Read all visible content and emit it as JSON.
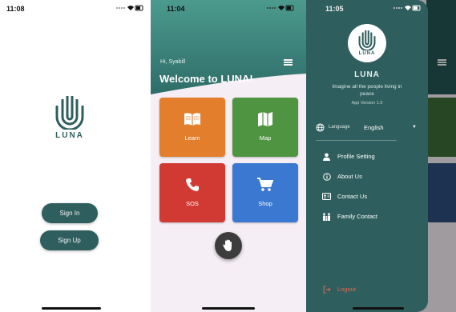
{
  "colors": {
    "brand": "#2f5e5e",
    "learn": "#e37f2c",
    "map": "#4f9440",
    "sos": "#d13a33",
    "shop": "#3a78d2",
    "logout": "#e0674e",
    "fab": "#3d3d3d"
  },
  "splash": {
    "status_time": "11:08",
    "brand": "LUNA",
    "signin_label": "Sign In",
    "signup_label": "Sign Up"
  },
  "home": {
    "status_time": "11:04",
    "greeting": "Hi, Syabill",
    "welcome": "Welcome to LUNA!",
    "tiles": [
      {
        "label": "Learn",
        "icon": "book-icon"
      },
      {
        "label": "Map",
        "icon": "map-icon"
      },
      {
        "label": "SOS",
        "icon": "phone-icon"
      },
      {
        "label": "Shop",
        "icon": "cart-icon"
      }
    ],
    "fab_icon": "hand-icon"
  },
  "drawer": {
    "status_time": "11:05",
    "brand": "LUNA",
    "title": "LUNA",
    "tagline": "Imagine all the people living in peace",
    "version": "App Version 1.0",
    "language_label": "Language",
    "language_value": "English",
    "menu": [
      {
        "label": "Profile Setting",
        "icon": "person-icon"
      },
      {
        "label": "About Us",
        "icon": "info-icon"
      },
      {
        "label": "Contact Us",
        "icon": "contact-card-icon"
      },
      {
        "label": "Family Contact",
        "icon": "family-icon"
      }
    ],
    "logout": "Logout"
  }
}
